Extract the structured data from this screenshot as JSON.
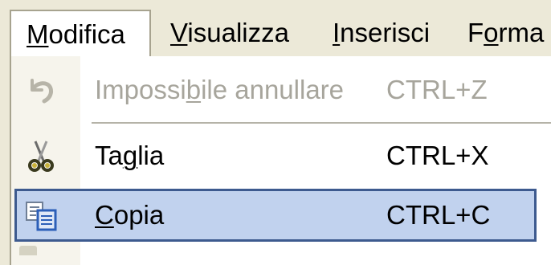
{
  "menubar": {
    "items": [
      {
        "pre": "",
        "accel": "M",
        "post": "odifica",
        "active": true
      },
      {
        "pre": "",
        "accel": "V",
        "post": "isualizza",
        "active": false
      },
      {
        "pre": "",
        "accel": "I",
        "post": "nserisci",
        "active": false
      },
      {
        "pre": "F",
        "accel": "o",
        "post": "rma",
        "active": false
      }
    ]
  },
  "dropdown": {
    "items": [
      {
        "pre": "Impossi",
        "accel": "b",
        "post": "ile annullare",
        "shortcut": "CTRL+Z",
        "icon": "undo-icon",
        "enabled": false
      },
      {
        "pre": "Ta",
        "accel": "g",
        "post": "lia",
        "shortcut": "CTRL+X",
        "icon": "scissors-icon",
        "enabled": true
      },
      {
        "pre": "",
        "accel": "C",
        "post": "opia",
        "shortcut": "CTRL+C",
        "icon": "copy-icon",
        "enabled": true,
        "highlighted": true
      }
    ]
  },
  "colors": {
    "menu_background": "#ece9d8",
    "highlight_fill": "#c1d2ee",
    "highlight_border": "#3d5a8f",
    "disabled_text": "#a7a59c"
  }
}
